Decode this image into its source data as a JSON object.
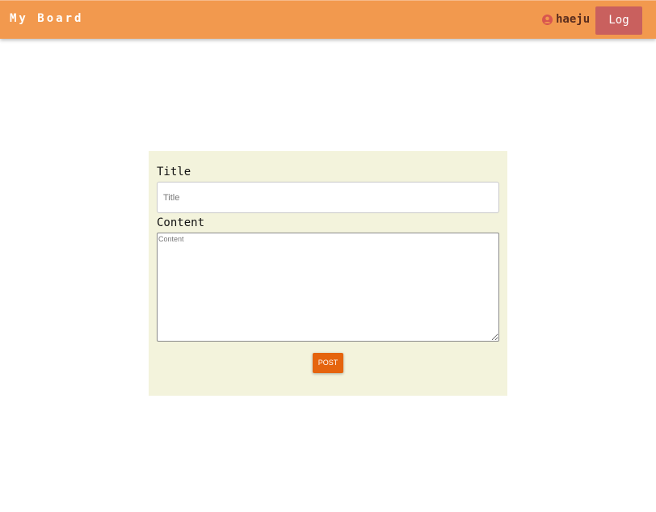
{
  "header": {
    "brand": "My Board",
    "user_icon": "user-circle-icon",
    "username": "haeju",
    "logout_label": "Log out"
  },
  "form": {
    "title_label": "Title",
    "title_placeholder": "Title",
    "title_value": "",
    "content_label": "Content",
    "content_placeholder": "Content",
    "content_value": "",
    "post_label": "POST"
  },
  "colors": {
    "header_bg": "#f2994e",
    "logout_bg": "#c9605e",
    "user_icon": "#d8564f",
    "card_bg": "#f3f3dc",
    "post_bg": "#e5640e"
  }
}
